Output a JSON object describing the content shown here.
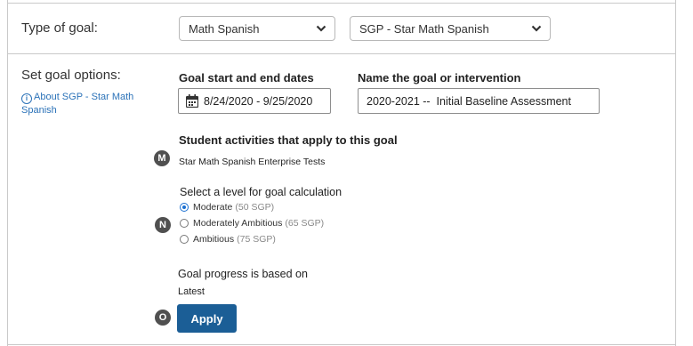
{
  "type_of_goal": {
    "label": "Type of goal:",
    "subject_select": {
      "value": "Math Spanish"
    },
    "goal_type_select": {
      "value": "SGP - Star Math Spanish"
    }
  },
  "goal_options": {
    "label": "Set goal options:",
    "about_link": "About SGP - Star Math Spanish",
    "dates": {
      "label": "Goal start and end dates",
      "value": "8/24/2020 - 9/25/2020"
    },
    "name": {
      "label": "Name the goal or intervention",
      "value": "2020-2021 --  Initial Baseline Assessment"
    },
    "activities": {
      "marker": "M",
      "label": "Student activities that apply to this goal",
      "value": "Star Math Spanish Enterprise Tests"
    },
    "level": {
      "marker": "N",
      "label": "Select a level for goal calculation",
      "options": [
        {
          "label": "Moderate",
          "detail": "(50 SGP)",
          "selected": true
        },
        {
          "label": "Moderately Ambitious",
          "detail": "(65 SGP)",
          "selected": false
        },
        {
          "label": "Ambitious",
          "detail": "(75 SGP)",
          "selected": false
        }
      ]
    },
    "progress": {
      "label": "Goal progress is based on",
      "value": "Latest"
    },
    "apply": {
      "marker": "O",
      "label": "Apply"
    }
  },
  "colors": {
    "accent": "#1b5e96",
    "link": "#2b72b8",
    "border": "#c9c9c9",
    "marker": "#505050",
    "radio_selected": "#1a6fd1"
  }
}
